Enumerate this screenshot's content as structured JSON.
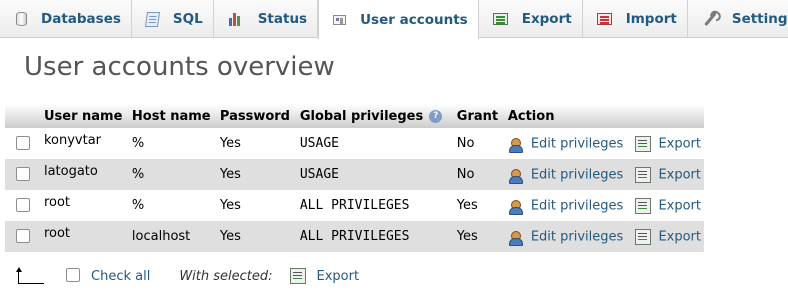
{
  "tabs": [
    {
      "label": "Databases",
      "icon": "database-icon"
    },
    {
      "label": "SQL",
      "icon": "sql-icon"
    },
    {
      "label": "Status",
      "icon": "status-chart-icon"
    },
    {
      "label": "User accounts",
      "icon": "user-accounts-icon",
      "active": true
    },
    {
      "label": "Export",
      "icon": "export-icon"
    },
    {
      "label": "Import",
      "icon": "import-icon"
    },
    {
      "label": "Settings",
      "icon": "wrench-icon"
    }
  ],
  "page_title": "User accounts overview",
  "table": {
    "headers": [
      "User name",
      "Host name",
      "Password",
      "Global privileges",
      "Grant",
      "Action"
    ],
    "rows": [
      {
        "user": "konyvtar",
        "host": "%",
        "password": "Yes",
        "privileges": "USAGE",
        "grant": "No"
      },
      {
        "user": "latogato",
        "host": "%",
        "password": "Yes",
        "privileges": "USAGE",
        "grant": "No"
      },
      {
        "user": "root",
        "host": "%",
        "password": "Yes",
        "privileges": "ALL PRIVILEGES",
        "grant": "Yes"
      },
      {
        "user": "root",
        "host": "localhost",
        "password": "Yes",
        "privileges": "ALL PRIVILEGES",
        "grant": "Yes"
      }
    ],
    "edit_label": "Edit privileges",
    "export_label": "Export"
  },
  "footer": {
    "check_all": "Check all",
    "with_selected": "With selected:",
    "export": "Export"
  },
  "colors": {
    "link": "#235a81",
    "row_alt": "#dfdfdf"
  }
}
